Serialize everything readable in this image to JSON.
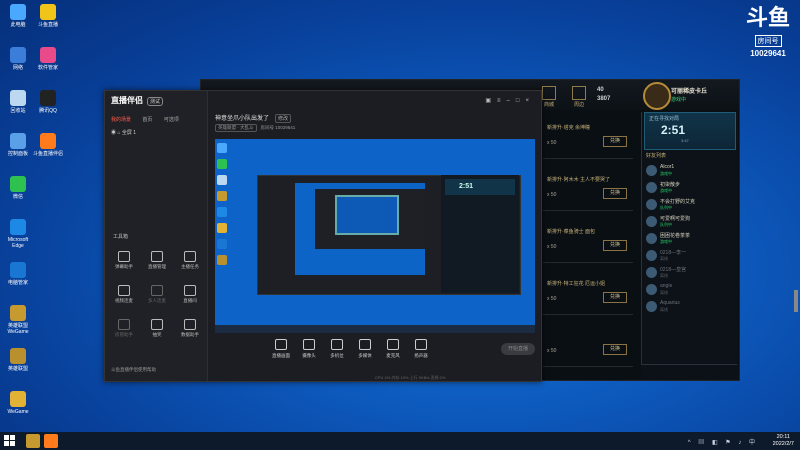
{
  "desktop": {
    "icons_col1": [
      {
        "label": "此电脑",
        "color": "#4aa8ff"
      },
      {
        "label": "网络",
        "color": "#3b7dd8"
      },
      {
        "label": "回收站",
        "color": "#bcd7f0"
      },
      {
        "label": "控制面板",
        "color": "#5aa0e8"
      },
      {
        "label": "微信",
        "color": "#2dc24f"
      },
      {
        "label": "Microsoft Edge",
        "color": "#1e88e5"
      },
      {
        "label": "电脑管家",
        "color": "#1976d2"
      },
      {
        "label": "英雄联盟 WeGame",
        "color": "#c79a2f"
      },
      {
        "label": "英雄联盟",
        "color": "#b8902e"
      },
      {
        "label": "WeGame",
        "color": "#e2b236"
      }
    ],
    "icons_col2": [
      {
        "label": "斗鱼直播",
        "color": "#f0c419"
      },
      {
        "label": "软件管家",
        "color": "#e84a8a"
      },
      {
        "label": "腾讯QQ",
        "color": "#222"
      },
      {
        "label": "斗鱼直播伴侣",
        "color": "#ff7b1c"
      }
    ],
    "watermark": {
      "glyph": "斗鱼",
      "room_label": "房间号",
      "room_number": "10029641"
    }
  },
  "game_client": {
    "top_buttons": [
      "商城",
      "周边"
    ],
    "currency": {
      "be": "40",
      "rp": "3807"
    },
    "player": {
      "name": "可丽稀皮卡丘",
      "status": "游戏中"
    },
    "match": {
      "label": "正在寻找对局",
      "time": "2:51",
      "sub": "3:47"
    },
    "friends_header": "好友列表",
    "friends": [
      {
        "name": "Alcor1",
        "status": "游戏中",
        "online": true
      },
      {
        "name": "初柒散步",
        "status": "游戏中",
        "online": true
      },
      {
        "name": "不会打野的艾克",
        "status": "队列中",
        "online": true
      },
      {
        "name": "可爱啊可爱狗",
        "status": "队列中",
        "online": true
      },
      {
        "name": "困困花卷茶茶",
        "status": "游戏中",
        "online": true
      },
      {
        "name": "0218—李一",
        "status": "离线",
        "online": false
      },
      {
        "name": "0218—皇宫",
        "status": "离线",
        "online": false
      },
      {
        "name": "angie",
        "status": "离线",
        "online": false
      },
      {
        "name": "Aquarius",
        "status": "离线",
        "online": false
      }
    ],
    "list_rows": [
      {
        "title": "新排升·塔克 余坤瞳",
        "count": "x 50",
        "button": "兑换"
      },
      {
        "title": "新排升·阿木木 主人不要哭了",
        "count": "x 50",
        "button": "兑换"
      },
      {
        "title": "新排升·菜鱼骑士 面包",
        "count": "x 50",
        "button": "兑换"
      },
      {
        "title": "新排升·特工狂花 厄运小姐",
        "count": "x 50",
        "button": "兑换"
      },
      {
        "title": "",
        "count": "x 50",
        "button": "兑换"
      }
    ]
  },
  "assistant": {
    "logo": "直播伴侣",
    "logo_tag": "测试",
    "tabs": [
      "我的场景",
      "首页",
      "可选项"
    ],
    "scene_label": "全屏 1",
    "tools_title": "工具箱",
    "tools": [
      {
        "label": "弹幕助手",
        "enabled": true
      },
      {
        "label": "直播管理",
        "enabled": true
      },
      {
        "label": "主播任务",
        "enabled": true
      },
      {
        "label": "视频连麦",
        "enabled": true
      },
      {
        "label": "多人连麦",
        "enabled": false
      },
      {
        "label": "直播间",
        "enabled": true
      },
      {
        "label": "房管助手",
        "enabled": false
      },
      {
        "label": "抽奖",
        "enabled": true
      },
      {
        "label": "数据助手",
        "enabled": true
      }
    ],
    "footer": "斗鱼直播伴侣使用帮助",
    "room_title": "神意坐爪小队出发了",
    "edit_label": "修改",
    "category": "英雄联盟 · 大乱斗",
    "room_meta": "房间号 10029641",
    "preview_timer": "2:51",
    "controls": [
      "直播画面",
      "摄像头",
      "多机位",
      "多媒体",
      "麦克风",
      "扬声器"
    ],
    "go_live": "开始直播",
    "status": "CPU 4%  内存 19%  上行 0KB/s  丢帧 0%"
  },
  "taskbar": {
    "time": "20:11",
    "date": "2022/2/7"
  }
}
